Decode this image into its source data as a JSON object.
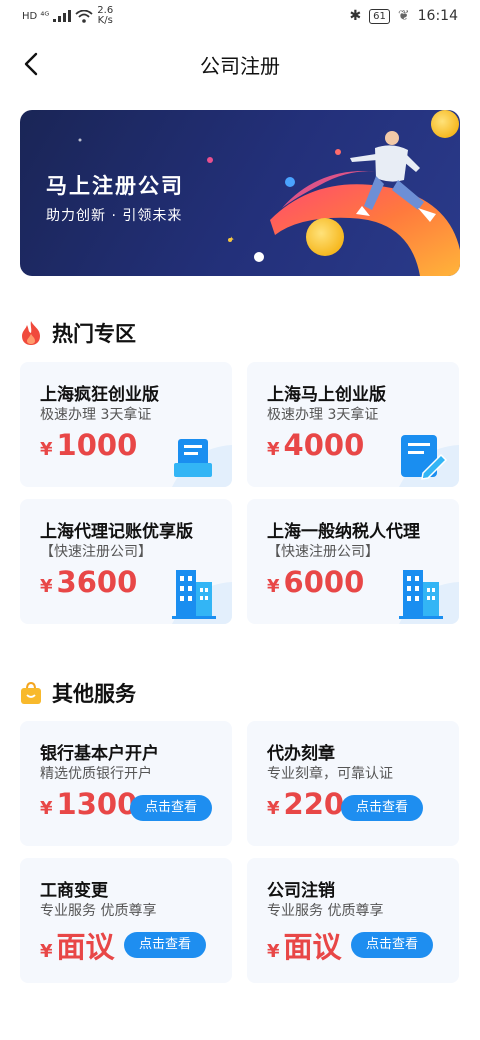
{
  "status_bar": {
    "network": "HD ⁴ᴳ",
    "speed_value": "2.6",
    "speed_unit": "K/s",
    "battery": "61",
    "time": "16:14"
  },
  "header": {
    "title": "公司注册"
  },
  "banner": {
    "title": "马上注册公司",
    "subtitle": "助力创新 · 引领未来"
  },
  "hot_section": {
    "title": "热门专区",
    "cards": [
      {
        "name": "上海疯狂创业版",
        "desc": "极速办理 3天拿证",
        "currency": "¥",
        "price": "1000",
        "icon": "id-card-icon"
      },
      {
        "name": "上海马上创业版",
        "desc": "极速办理 3天拿证",
        "currency": "¥",
        "price": "4000",
        "icon": "document-edit-icon"
      },
      {
        "name": "上海代理记账优享版",
        "desc": "【快速注册公司】",
        "currency": "¥",
        "price": "3600",
        "icon": "building-icon"
      },
      {
        "name": "上海一般纳税人代理",
        "desc": "【快速注册公司】",
        "currency": "¥",
        "price": "6000",
        "icon": "building-icon"
      }
    ]
  },
  "other_section": {
    "title": "其他服务",
    "cards": [
      {
        "name": "银行基本户开户",
        "desc": "精选优质银行开户",
        "currency": "¥",
        "price": "1300",
        "button": "点击查看"
      },
      {
        "name": "代办刻章",
        "desc": "专业刻章，可靠认证",
        "currency": "¥",
        "price": "220",
        "button": "点击查看"
      },
      {
        "name": "工商变更",
        "desc": "专业服务 优质尊享",
        "currency": "¥",
        "price": "面议",
        "button": "点击查看"
      },
      {
        "name": "公司注销",
        "desc": "专业服务 优质尊享",
        "currency": "¥",
        "price": "面议",
        "button": "点击查看"
      }
    ]
  },
  "colors": {
    "accent": "#1e8ef0",
    "price": "#e84747",
    "card_bg": "#f5f8fd",
    "banner_bg": "#1a2556"
  }
}
